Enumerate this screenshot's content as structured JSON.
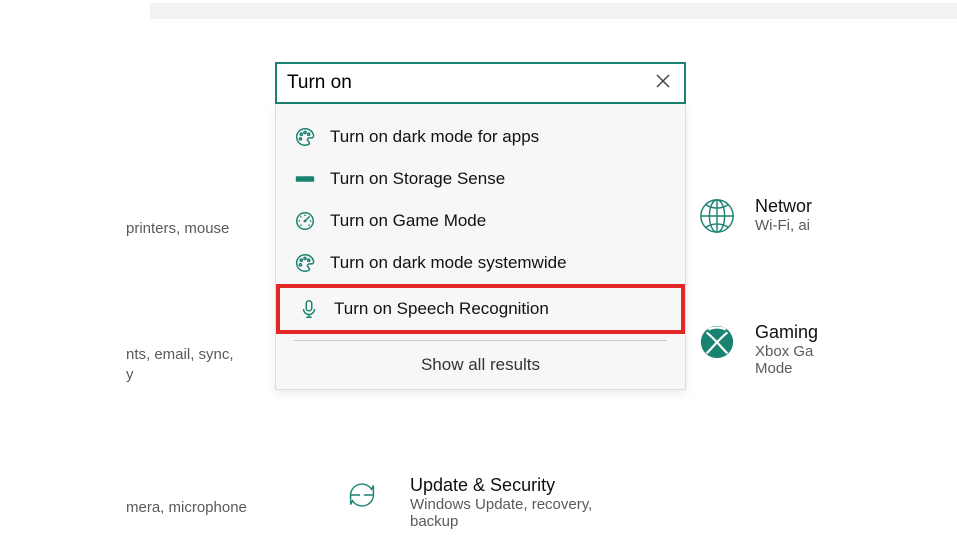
{
  "search": {
    "value": "Turn on",
    "clear_title": "Clear"
  },
  "suggestions": [
    {
      "icon": "palette-icon",
      "label": "Turn on dark mode for apps"
    },
    {
      "icon": "storage-icon",
      "label": "Turn on Storage Sense"
    },
    {
      "icon": "gauge-icon",
      "label": "Turn on Game Mode"
    },
    {
      "icon": "palette-icon",
      "label": "Turn on dark mode systemwide"
    },
    {
      "icon": "microphone-icon",
      "label": "Turn on Speech Recognition",
      "highlighted": true
    }
  ],
  "show_all_label": "Show all results",
  "bg": {
    "devices_sub": "printers, mouse",
    "accounts_sub1": "nts, email, sync,",
    "accounts_sub2": "y",
    "privacy_sub": "mera, microphone",
    "network_title": "Networ",
    "network_sub": "Wi-Fi, ai",
    "gaming_title": "Gaming",
    "gaming_sub1": "Xbox Ga",
    "gaming_sub2": "Mode",
    "update_title": "Update & Security",
    "update_sub": "Windows Update, recovery, backup"
  },
  "colors": {
    "accent": "#1a8270",
    "highlight_border": "#e32626"
  }
}
